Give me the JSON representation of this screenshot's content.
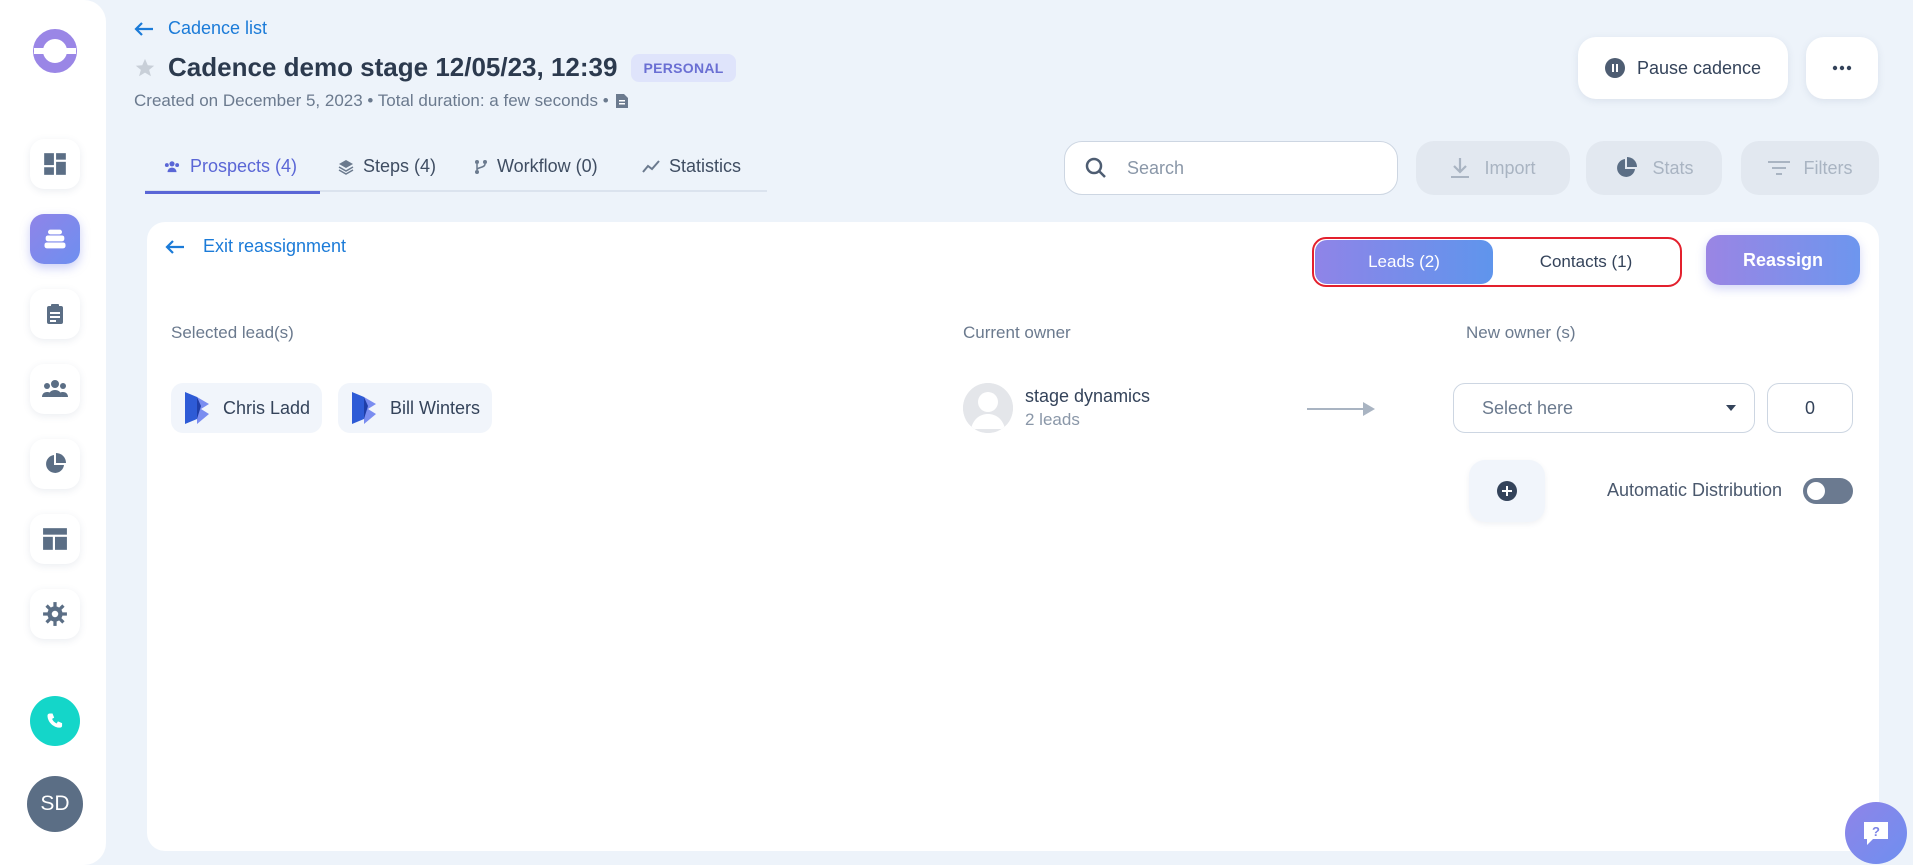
{
  "header": {
    "back_label": "Cadence list",
    "title": "Cadence demo stage 12/05/23, 12:39",
    "badge": "PERSONAL",
    "subtitle": "Created on December 5, 2023 • Total duration: a few seconds •",
    "pause_label": "Pause cadence"
  },
  "tabs": [
    {
      "label": "Prospects (4)",
      "icon": "people-icon",
      "active": true
    },
    {
      "label": "Steps (4)",
      "icon": "layers-icon",
      "active": false
    },
    {
      "label": "Workflow (0)",
      "icon": "workflow-icon",
      "active": false
    },
    {
      "label": "Statistics",
      "icon": "chart-line-icon",
      "active": false
    }
  ],
  "toolbar": {
    "search_placeholder": "Search",
    "import_label": "Import",
    "stats_label": "Stats",
    "filters_label": "Filters"
  },
  "reassign": {
    "exit_label": "Exit reassignment",
    "toggle": {
      "leads": "Leads (2)",
      "contacts": "Contacts (1)"
    },
    "reassign_label": "Reassign",
    "columns": {
      "selected": "Selected lead(s)",
      "current": "Current owner",
      "new": "New owner (s)"
    },
    "leads": [
      {
        "name": "Chris Ladd"
      },
      {
        "name": "Bill Winters"
      }
    ],
    "current_owner": {
      "name": "stage dynamics",
      "count": "2 leads"
    },
    "select_placeholder": "Select here",
    "quantity": "0",
    "auto_label": "Automatic Distribution"
  },
  "sidebar": {
    "avatar_initials": "SD"
  },
  "colors": {
    "accent": "#5a66d6",
    "link": "#1b7bd8",
    "teal": "#14d6c9",
    "highlight_border": "#e3202d"
  }
}
